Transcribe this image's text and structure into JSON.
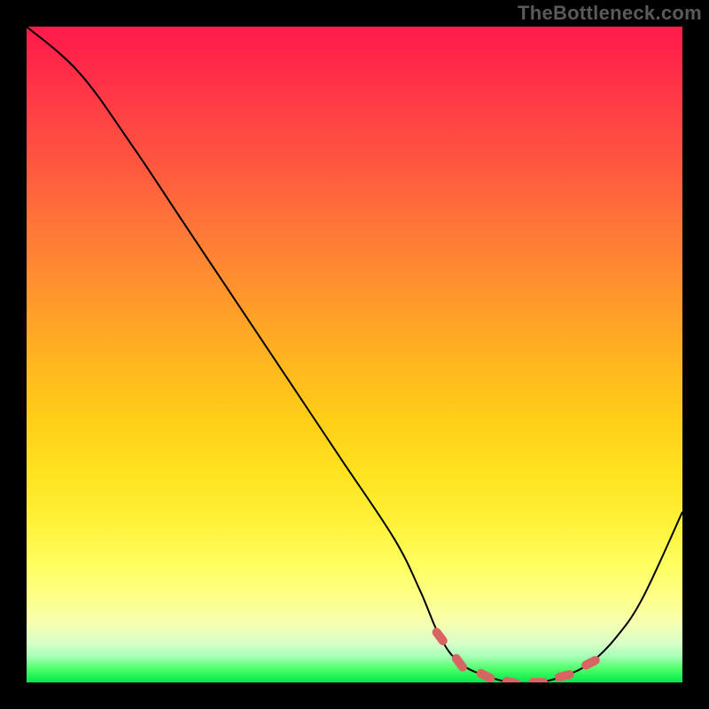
{
  "watermark": "TheBottleneck.com",
  "chart_data": {
    "type": "line",
    "title": "",
    "xlabel": "",
    "ylabel": "",
    "xlim": [
      0,
      100
    ],
    "ylim": [
      0,
      100
    ],
    "grid": false,
    "legend": false,
    "series": [
      {
        "name": "bottleneck-curve",
        "x": [
          0,
          8,
          16,
          24,
          32,
          40,
          48,
          56,
          60,
          63,
          66,
          70,
          74,
          78,
          82,
          86,
          90,
          94,
          100
        ],
        "values": [
          100,
          93,
          82,
          70,
          58,
          46,
          34,
          22,
          14,
          7,
          3,
          1,
          0,
          0,
          1,
          3,
          7,
          13,
          26
        ]
      }
    ],
    "markers": {
      "name": "optimal-range-markers",
      "color": "#d86464",
      "x": [
        63,
        66,
        70,
        74,
        78,
        82,
        86
      ],
      "values": [
        7,
        3,
        1,
        0,
        0,
        1,
        3
      ]
    },
    "background_gradient": {
      "top_color": "#ff1a4a",
      "bottom_color": "#00e84a",
      "note": "red-to-green vertical gradient signifying bottleneck severity"
    }
  }
}
